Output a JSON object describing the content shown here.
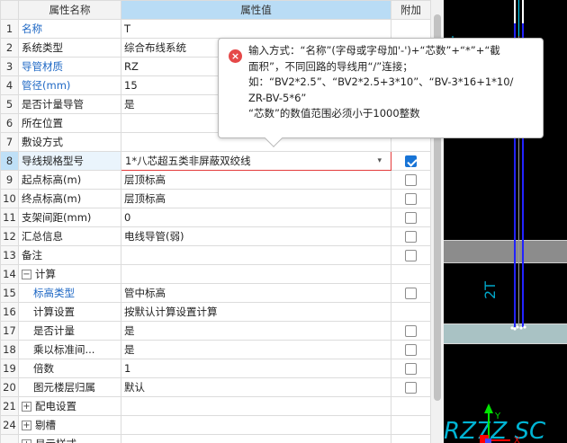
{
  "header": {
    "name": "属性名称",
    "value": "属性值",
    "add": "附加"
  },
  "rows": [
    {
      "idx": "1",
      "name": "名称",
      "value": "T",
      "blue": true,
      "cb": null
    },
    {
      "idx": "2",
      "name": "系统类型",
      "value": "综合布线系统",
      "cb": null
    },
    {
      "idx": "3",
      "name": "导管材质",
      "value": "RZ",
      "blue": true,
      "cb": null
    },
    {
      "idx": "4",
      "name": "管径(mm)",
      "value": "15",
      "blue": true,
      "cb": null
    },
    {
      "idx": "5",
      "name": "是否计量导管",
      "value": "是",
      "cb": null
    },
    {
      "idx": "6",
      "name": "所在位置",
      "value": "",
      "cb": null
    },
    {
      "idx": "7",
      "name": "敷设方式",
      "value": "",
      "cb": null
    },
    {
      "idx": "8",
      "name": "导线规格型号",
      "value": "1*八芯超五类非屏蔽双绞线",
      "cb": true,
      "selected": true,
      "combo": true
    },
    {
      "idx": "9",
      "name": "起点标高(m)",
      "value": "层顶标高",
      "cb": false
    },
    {
      "idx": "10",
      "name": "终点标高(m)",
      "value": "层顶标高",
      "cb": false
    },
    {
      "idx": "11",
      "name": "支架间距(mm)",
      "value": "0",
      "cb": false
    },
    {
      "idx": "12",
      "name": "汇总信息",
      "value": "电线导管(弱)",
      "cb": false
    },
    {
      "idx": "13",
      "name": "备注",
      "value": "",
      "cb": false
    },
    {
      "idx": "14",
      "name": "计算",
      "value": "",
      "tree": "-",
      "cb": null
    },
    {
      "idx": "15",
      "name": "标高类型",
      "value": "管中标高",
      "blue": true,
      "sub": true,
      "cb": false
    },
    {
      "idx": "16",
      "name": "计算设置",
      "value": "按默认计算设置计算",
      "sub": true,
      "cb": null
    },
    {
      "idx": "17",
      "name": "是否计量",
      "value": "是",
      "sub": true,
      "cb": false
    },
    {
      "idx": "18",
      "name": "乘以标准间...",
      "value": "是",
      "sub": true,
      "cb": false
    },
    {
      "idx": "19",
      "name": "倍数",
      "value": "1",
      "sub": true,
      "cb": false
    },
    {
      "idx": "20",
      "name": "图元楼层归属",
      "value": "默认",
      "sub": true,
      "cb": false
    },
    {
      "idx": "21",
      "name": "配电设置",
      "value": "",
      "tree": "+",
      "cb": null
    },
    {
      "idx": "24",
      "name": "剔槽",
      "value": "",
      "tree": "+",
      "cb": null
    },
    {
      "idx": "",
      "name": "显示样式",
      "value": "",
      "tree": "+",
      "cb": null
    }
  ],
  "tooltip": {
    "lines": [
      "输入方式：“名称”(字母或字母加'-')+“芯数”+“*”+“截",
      "面积”，不同回路的导线用“/”连接；",
      "如：“BV2*2.5”、“BV2*2.5+3*10”、“BV-3*16+1*10/",
      "ZR-BV-5*6”",
      "“芯数”的数值范围必须小于1000整数"
    ]
  },
  "canvas": {
    "label_2t": "2T",
    "label_bottom": "RZ7Z SC"
  },
  "colors": {
    "accent_blue": "#1d67c4",
    "error_red": "#e43b3b",
    "wire_blue": "#2323ff",
    "cad_cyan": "#00a6c8"
  }
}
